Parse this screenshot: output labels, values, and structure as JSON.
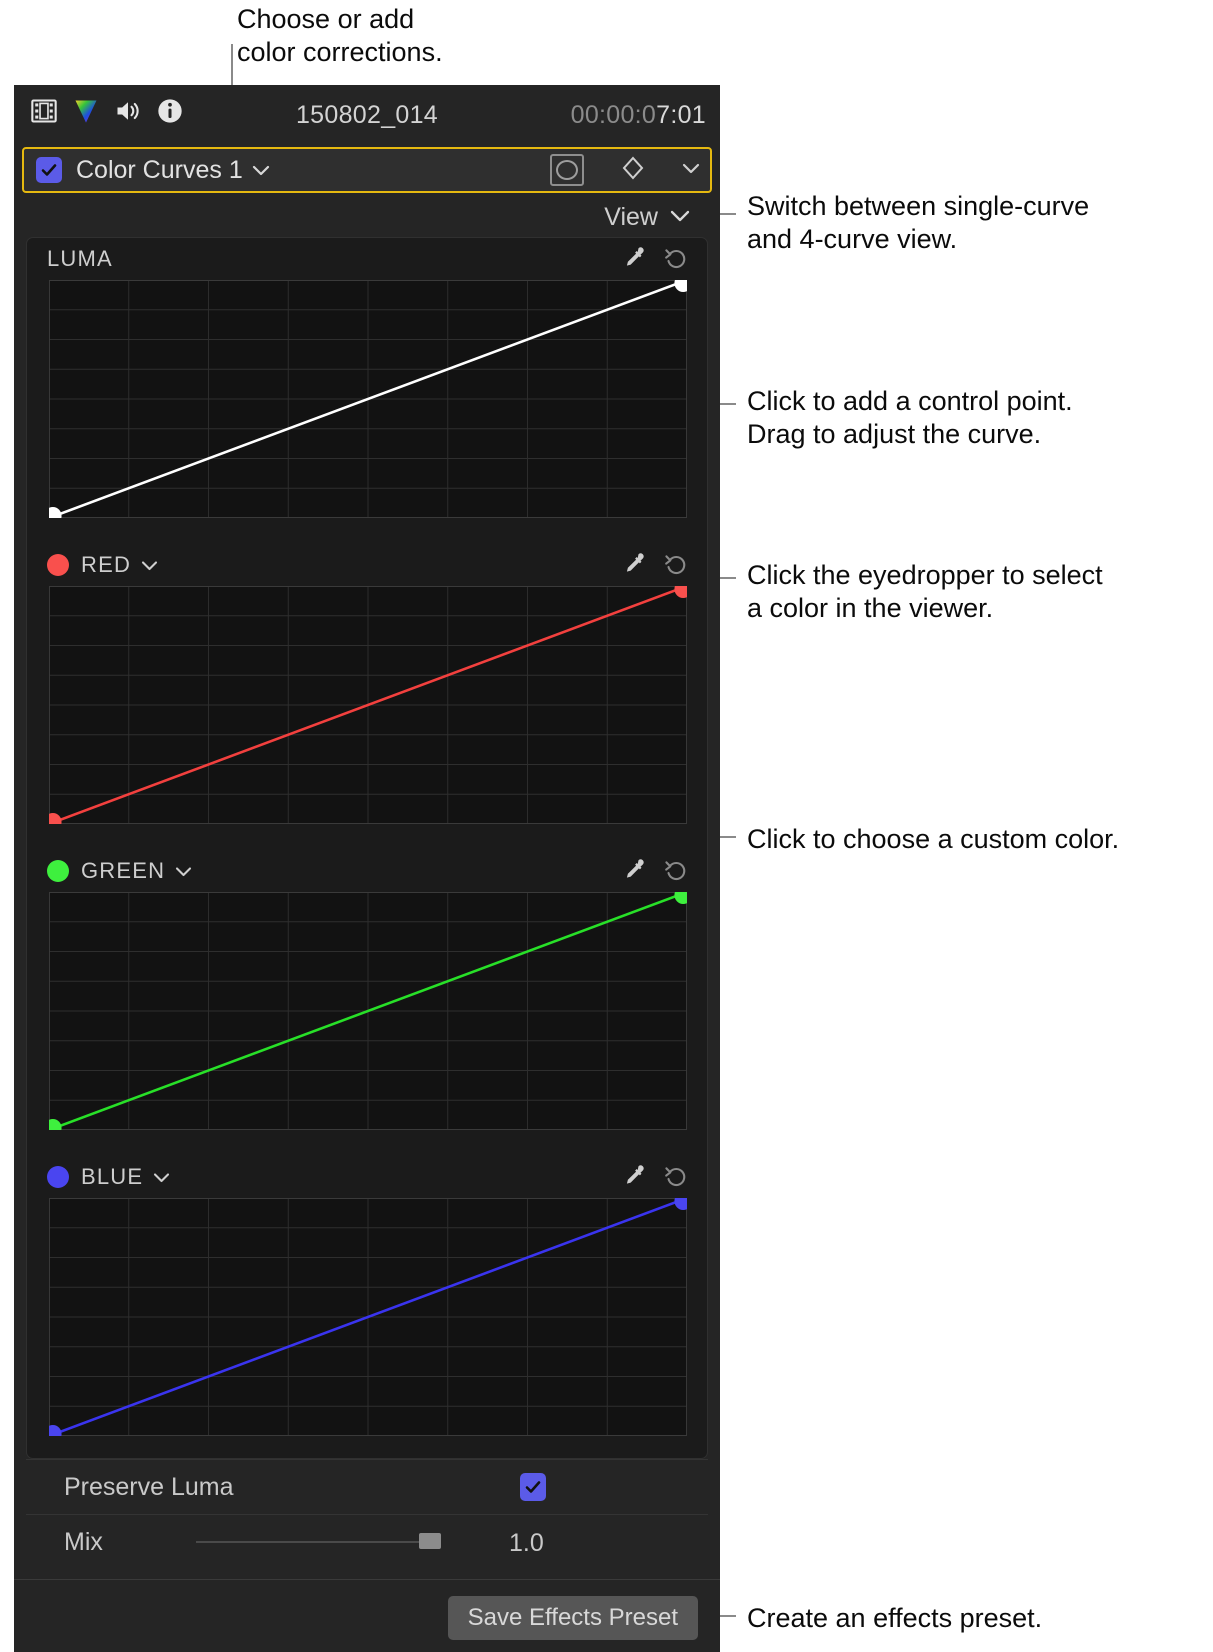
{
  "annotations": [
    {
      "id": "choose-add",
      "text": "Choose or add\ncolor corrections."
    },
    {
      "id": "switch-view",
      "text": "Switch between single-curve\nand 4-curve view."
    },
    {
      "id": "add-control-point",
      "text": "Click to add a control point.\nDrag to adjust the curve."
    },
    {
      "id": "eyedropper",
      "text": "Click the eyedropper to select\na color in the viewer."
    },
    {
      "id": "custom-color",
      "text": "Click to choose a custom color."
    },
    {
      "id": "effects-preset",
      "text": "Create an effects preset."
    }
  ],
  "inspector": {
    "header": {
      "icons": [
        "film-strip-icon",
        "color-wheel-icon",
        "audio-speaker-icon",
        "info-icon"
      ],
      "clip_name": "150802_014",
      "timecode_dim": "00:00:0",
      "timecode_bright": "7:01"
    },
    "effect": {
      "enabled": true,
      "name": "Color Curves 1",
      "disclosure_icon": "chevron-down-icon",
      "mask_icon": "shape-mask-icon",
      "keyframe_icon": "keyframe-diamond-icon",
      "keyframe_menu_icon": "chevron-down-icon"
    },
    "view": {
      "label": "View",
      "icon": "chevron-down-icon"
    },
    "curves": [
      {
        "id": "luma",
        "label": "LUMA",
        "swatch": null,
        "color": "#ffffff",
        "has_popup": false,
        "eyedropper_icon": "eyedropper-icon",
        "reset_icon": "reset-arrow-icon"
      },
      {
        "id": "red",
        "label": "RED",
        "swatch": "#f9504d",
        "color": "#f2403e",
        "has_popup": true,
        "eyedropper_icon": "eyedropper-icon",
        "reset_icon": "reset-arrow-icon"
      },
      {
        "id": "green",
        "label": "GREEN",
        "swatch": "#3ef03e",
        "color": "#28e028",
        "has_popup": true,
        "eyedropper_icon": "eyedropper-icon",
        "reset_icon": "reset-arrow-icon"
      },
      {
        "id": "blue",
        "label": "BLUE",
        "swatch": "#4a45f0",
        "color": "#3a34ef",
        "has_popup": true,
        "eyedropper_icon": "eyedropper-icon",
        "reset_icon": "reset-arrow-icon"
      }
    ],
    "params": {
      "preserve_luma_label": "Preserve Luma",
      "preserve_luma_checked": true,
      "mix_label": "Mix",
      "mix_value": "1.0"
    },
    "save_preset_label": "Save Effects Preset"
  },
  "chart_data": {
    "type": "line",
    "title": "Color Curves",
    "description": "Four identity curves mapping input to output from 0,0 to 1,1",
    "axis": {
      "xlim": [
        0,
        1
      ],
      "ylim": [
        0,
        1
      ],
      "grid": true,
      "grid_cols": 8,
      "grid_rows": 8
    },
    "series": [
      {
        "name": "LUMA",
        "color": "#ffffff",
        "points": [
          [
            0,
            0
          ],
          [
            1,
            1
          ]
        ]
      },
      {
        "name": "RED",
        "color": "#f2403e",
        "points": [
          [
            0,
            0
          ],
          [
            1,
            1
          ]
        ]
      },
      {
        "name": "GREEN",
        "color": "#28e028",
        "points": [
          [
            0,
            0
          ],
          [
            1,
            1
          ]
        ]
      },
      {
        "name": "BLUE",
        "color": "#3a34ef",
        "points": [
          [
            0,
            0
          ],
          [
            1,
            1
          ]
        ]
      }
    ]
  }
}
